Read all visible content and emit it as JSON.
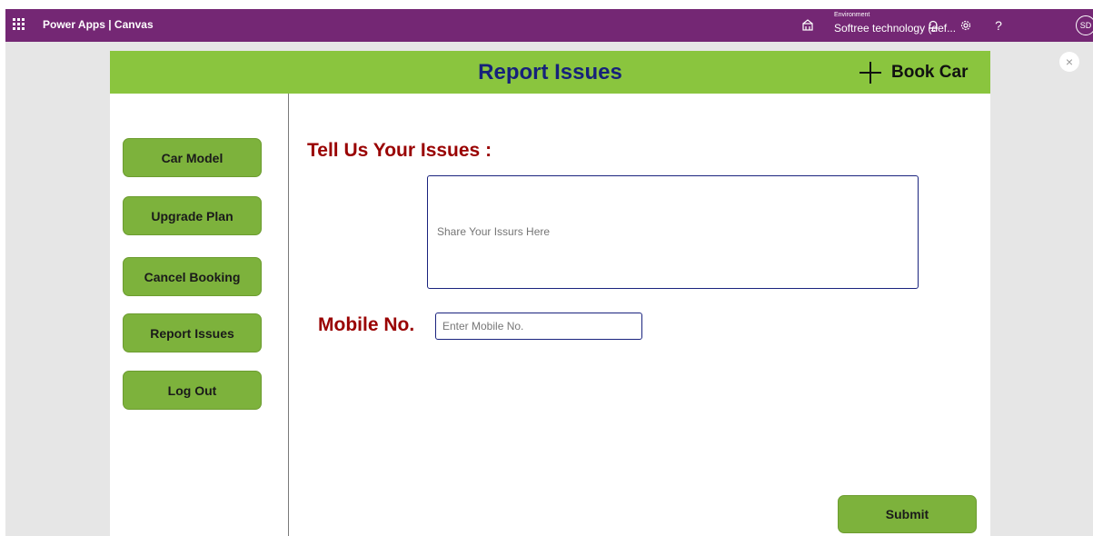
{
  "topbar": {
    "app_title": "Power Apps | Canvas",
    "env_label": "Environment",
    "env_name": "Softree technology (def...",
    "help_glyph": "?",
    "avatar_initials": "SD",
    "color": "#742774"
  },
  "canvas": {
    "close_glyph": "×"
  },
  "header": {
    "title": "Report Issues",
    "book_car_label": "Book Car",
    "color": "#8ac53e",
    "title_color": "#16227a"
  },
  "sidebar": {
    "items": [
      {
        "label": "Car Model"
      },
      {
        "label": "Upgrade Plan"
      },
      {
        "label": "Cancel Booking"
      },
      {
        "label": "Report Issues"
      },
      {
        "label": "Log Out"
      }
    ],
    "button_color": "#7db23c"
  },
  "form": {
    "issues_heading": "Tell Us Your Issues :",
    "issues_placeholder": "Share Your Issurs Here",
    "issues_value": "",
    "mobile_label": "Mobile No.",
    "mobile_placeholder": "Enter Mobile No.",
    "mobile_value": "",
    "submit_label": "Submit",
    "heading_color": "#990000"
  },
  "icons": {
    "waffle": "app-launcher-icon",
    "environment": "environment-icon",
    "bell": "notification-bell-icon",
    "gear": "settings-gear-icon",
    "help": "help-icon",
    "plus": "plus-icon",
    "close": "close-icon"
  }
}
